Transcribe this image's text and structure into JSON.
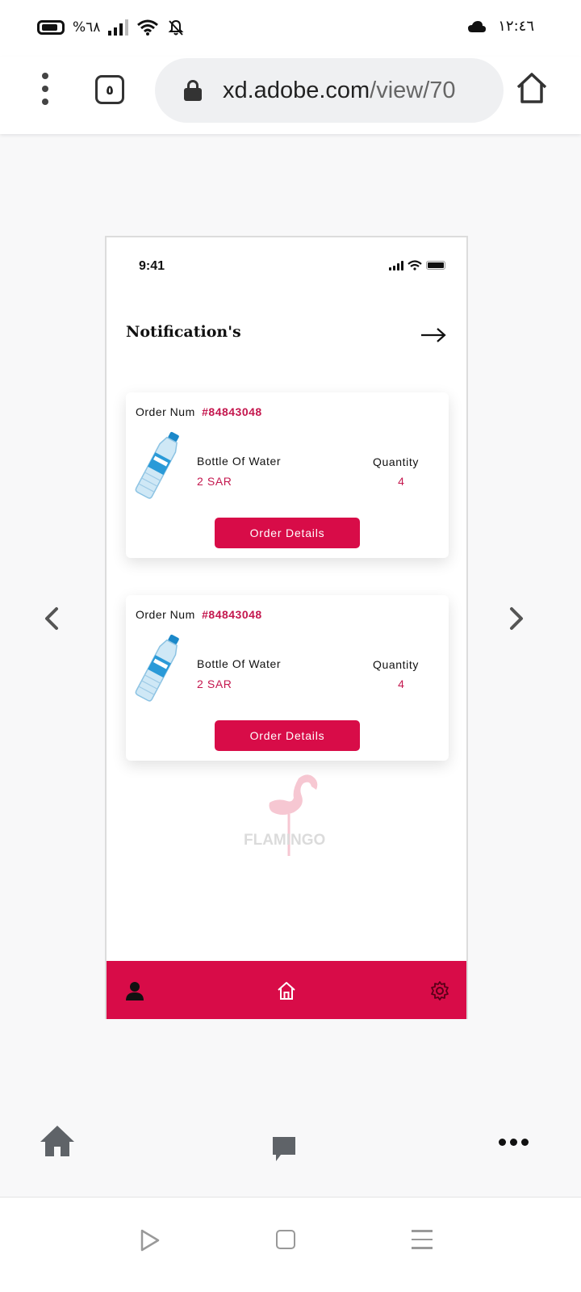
{
  "status_bar": {
    "battery_percent": "%٦٨",
    "time": "١٢:٤٦"
  },
  "browser": {
    "tab_count": "٥",
    "url_host": "xd.adobe.com",
    "url_path": "/view/70"
  },
  "mockup": {
    "ios_time": "9:41",
    "title": "Notification's",
    "orders": [
      {
        "order_label": "Order Num",
        "order_number": "#84843048",
        "product_name": "Bottle Of Water",
        "price": "2 SAR",
        "quantity_label": "Quantity",
        "quantity": "4",
        "button_label": "Order Details"
      },
      {
        "order_label": "Order Num",
        "order_number": "#84843048",
        "product_name": "Bottle Of Water",
        "price": "2 SAR",
        "quantity_label": "Quantity",
        "quantity": "4",
        "button_label": "Order Details"
      }
    ],
    "watermark_text": "FLAMINGO",
    "nav_items": [
      "profile-icon",
      "home-icon",
      "settings-icon"
    ]
  },
  "colors": {
    "accent": "#d80c48",
    "accent_text": "#c4174e",
    "page_bg": "#f8f8f9"
  }
}
